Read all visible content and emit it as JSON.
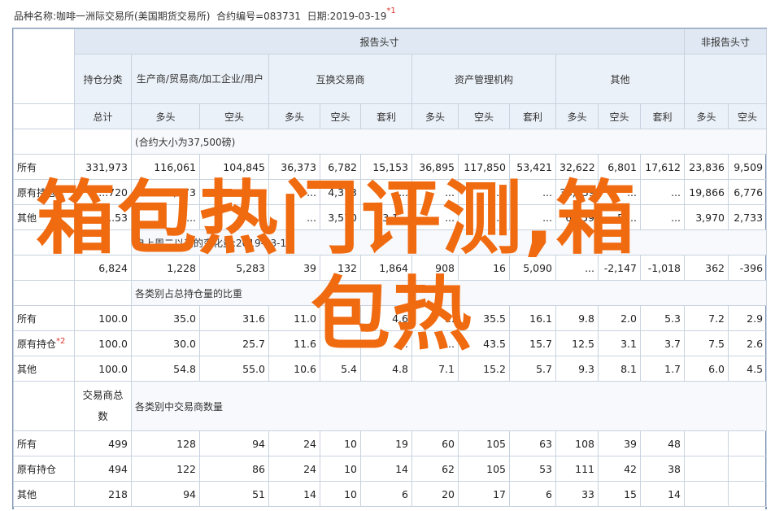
{
  "topline": {
    "prefix_label": "品种名称:",
    "name": "咖啡一洲际交易所(美国期货交易所)",
    "code_label": "合约编号=",
    "code": "083731",
    "date_label": "日期:",
    "date": "2019-03-19",
    "footnote": "*1"
  },
  "header": {
    "report_group": "报告头寸",
    "nonreport_group": "非报告头寸",
    "holding_class": "持仓分类",
    "producer": "生产商/贸易商/加工企业/用户",
    "swap": "互换交易商",
    "managed": "资产管理机构",
    "other": "其他",
    "total": "总计",
    "long": "多头",
    "short": "空头",
    "spread": "套利"
  },
  "sections": {
    "contract_size": "(合约大小为37,500磅)",
    "change": "自上周二以来的变化量:2019-03-12",
    "ratio": "各类别占总持仓量的比重",
    "trader_count_label": "交易商总数",
    "trader_count_by_cat": "各类别中交易商数量"
  },
  "row_labels": {
    "all": "所有",
    "old": "原有持仓",
    "other": "其他",
    "old_footnote": "*2"
  },
  "positions": [
    {
      "label": "所有",
      "values": [
        "331,973",
        "116,061",
        "104,845",
        "36,373",
        "6,782",
        "15,153",
        "36,895",
        "117,850",
        "53,421",
        "32,622",
        "6,801",
        "17,612",
        "23,836",
        "9,509"
      ]
    },
    {
      "label": "原有持仓",
      "values": [
        "...720",
        "79,673",
        "...",
        "...",
        "4,373",
        "...",
        "...",
        "...",
        "...",
        "33,239",
        "...",
        "...",
        "19,866",
        "6,776"
      ]
    },
    {
      "label": "其他",
      "values": [
        "...53",
        "...",
        "...",
        "...",
        "3,570",
        "3,1...",
        "...",
        "...",
        "...",
        "6,159",
        "5,...",
        "...",
        "3,970",
        "2,733"
      ]
    }
  ],
  "changes": [
    "6,824",
    "1,228",
    "5,283",
    "39",
    "132",
    "1,864",
    "908",
    "16",
    "5,090",
    "...",
    "-2,147",
    "-1,018",
    "362",
    "-396"
  ],
  "ratios": [
    {
      "label": "所有",
      "values": [
        "100.0",
        "35.0",
        "31.6",
        "11.0",
        "...",
        "4.6",
        "...",
        "35.5",
        "16.1",
        "9.8",
        "2.0",
        "5.3",
        "7.2",
        "2.9"
      ]
    },
    {
      "label": "原有持仓",
      "footnote": "*2",
      "values": [
        "100.0",
        "30.0",
        "25.7",
        "11.6",
        "...",
        "...",
        "...",
        "43.5",
        "15.7",
        "12.5",
        "3.1",
        "3.7",
        "7.5",
        "2.6"
      ]
    },
    {
      "label": "其他",
      "values": [
        "100.0",
        "54.8",
        "55.0",
        "10.6",
        "5.4",
        "4.8",
        "7.1",
        "15.2",
        "5.7",
        "9.3",
        "8.1",
        "1.7",
        "6.0",
        "4.5"
      ]
    }
  ],
  "traders": [
    {
      "label": "所有",
      "values": [
        "499",
        "128",
        "94",
        "24",
        "10",
        "19",
        "60",
        "105",
        "63",
        "108",
        "39",
        "48",
        "",
        ""
      ]
    },
    {
      "label": "原有持仓",
      "values": [
        "494",
        "122",
        "86",
        "24",
        "10",
        "14",
        "62",
        "105",
        "53",
        "111",
        "42",
        "38",
        "",
        ""
      ]
    },
    {
      "label": "其他",
      "values": [
        "218",
        "94",
        "51",
        "14",
        "10",
        "6",
        "20",
        "17",
        "6",
        "33",
        "15",
        "14",
        "",
        ""
      ]
    }
  ],
  "overlay": {
    "line1": "箱包热门评测,箱",
    "line2": "包热"
  },
  "colors": {
    "header_bg": "#dfe8f3",
    "border": "#c8d3df",
    "frame": "#7f96b3",
    "overlay": "#f06a10",
    "footnote": "#d9342b"
  }
}
